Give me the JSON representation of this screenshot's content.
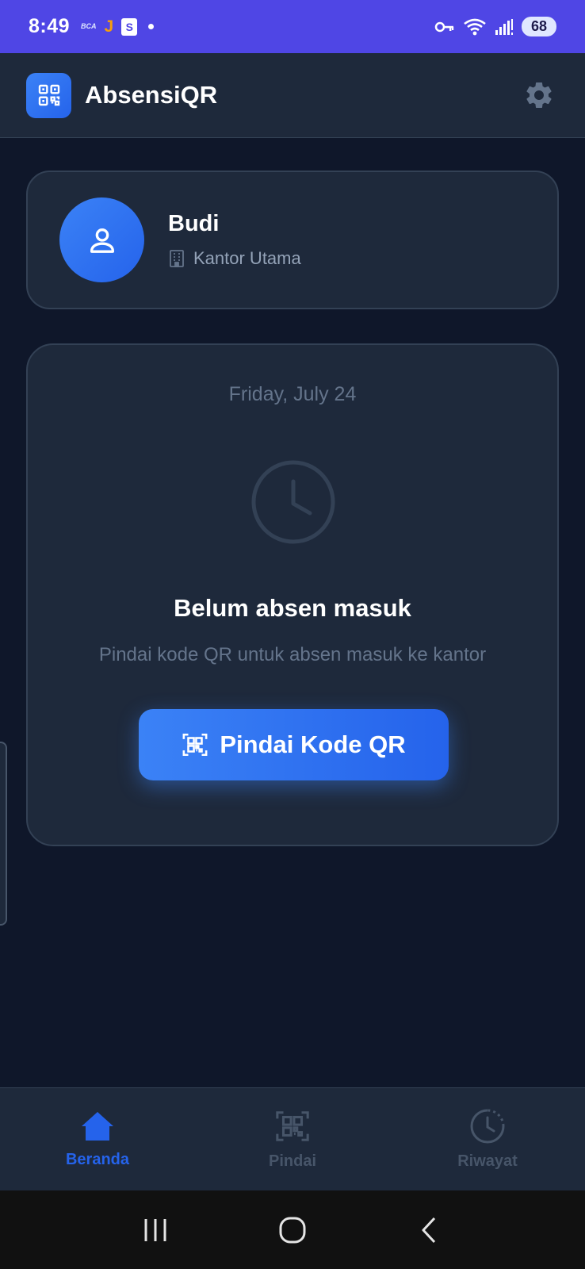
{
  "status_bar": {
    "time": "8:49",
    "bca_label": "BCA",
    "j_label": "J",
    "shop_label": "S",
    "battery": "68"
  },
  "app_bar": {
    "title": "AbsensiQR",
    "logo_icon": "qr-code-icon",
    "settings_icon": "gear-icon"
  },
  "profile": {
    "name": "Budi",
    "office": "Kantor Utama",
    "avatar_icon": "user-icon",
    "office_icon": "building-icon"
  },
  "attendance": {
    "date": "Friday, July 24",
    "status_title": "Belum absen masuk",
    "status_description": "Pindai kode QR untuk absen masuk ke kantor",
    "scan_button_label": "Pindai Kode QR",
    "scan_button_icon": "qr-scan-icon"
  },
  "bottom_nav": {
    "items": [
      {
        "label": "Beranda",
        "icon": "home-icon",
        "active": true
      },
      {
        "label": "Pindai",
        "icon": "qr-scan-icon",
        "active": false
      },
      {
        "label": "Riwayat",
        "icon": "history-icon",
        "active": false
      }
    ]
  },
  "colors": {
    "status_bar": "#4f46e5",
    "background": "#0f172a",
    "card": "#1e293b",
    "accent": "#2563eb",
    "muted": "#64748b"
  }
}
